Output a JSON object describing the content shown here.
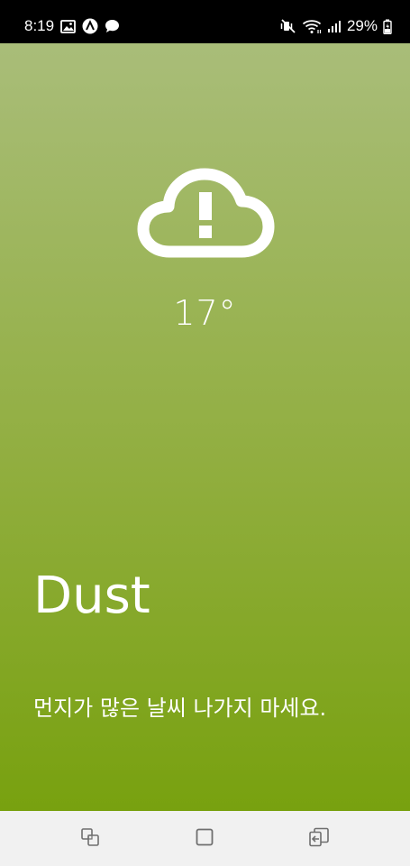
{
  "status_bar": {
    "time": "8:19",
    "battery": "29%",
    "icons": [
      "image-icon",
      "app-a-icon",
      "chat-icon",
      "mute-vibrate-icon",
      "wifi-icon",
      "signal-icon",
      "battery-icon"
    ]
  },
  "weather": {
    "icon": "cloud-alert-icon",
    "temperature": "17°",
    "condition": "Dust",
    "message": "먼지가 많은 날씨 나가지 마세요."
  },
  "nav_bar": {
    "buttons": [
      "recent-apps-icon",
      "home-icon",
      "back-icon"
    ]
  },
  "colors": {
    "status_bar_bg": "#000000",
    "gradient_top": "#a9bd79",
    "gradient_bottom": "#78a10f",
    "text": "#ffffff",
    "nav_bar_bg": "#f1f1f1",
    "nav_icon": "#6f6f6f"
  }
}
